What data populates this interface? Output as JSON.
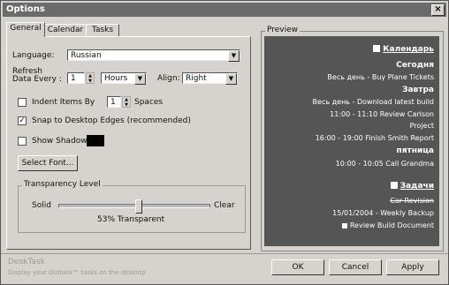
{
  "window": {
    "title": "Options"
  },
  "tabs": [
    "General",
    "Calendar",
    "Tasks"
  ],
  "general": {
    "language_label": "Language:",
    "language_value": "Russian",
    "refresh_label_line1": "Refresh",
    "refresh_label_line2": "Data Every :",
    "refresh_value": "1",
    "refresh_unit": "Hours",
    "align_label": "Align:",
    "align_value": "Right",
    "indent_label": "Indent Items By",
    "indent_value": "1",
    "indent_unit": "Spaces",
    "snap_label": "Snap to Desktop Edges (recommended)",
    "shadow_label": "Show Shadow",
    "select_font_label": "Select Font...",
    "transparency_group": "Transparency Level",
    "solid_label": "Solid",
    "clear_label": "Clear",
    "transparency_text": "53% Transparent",
    "transparency_fraction": 0.53
  },
  "preview": {
    "label": "Preview",
    "calendar_title": "Календарь",
    "today": "Сегодня",
    "today_item": "Весь день - Buy Plane Tickets",
    "tomorrow": "Завтра",
    "tomorrow_item": "Весь день - Download latest build",
    "tomorrow_item2_l1": "11:00 - 11:10 Review Carlson",
    "tomorrow_item2_l2": "Project",
    "tomorrow_item3": "16:00 - 19:00 Finish Smith Report",
    "friday": "пятница",
    "friday_item": "10:00 - 10:05 Call Grandma",
    "tasks_title": "Задачи",
    "task1": "Car Revision",
    "task2": "15/01/2004 - Weekly Backup",
    "task3": "Review Build Document"
  },
  "footer": {
    "app_name": "DeskTask",
    "tagline": "Display your Outlook™ tasks on the desktop"
  },
  "buttons": {
    "ok": "OK",
    "cancel": "Cancel",
    "apply": "Apply"
  },
  "colors": {
    "preview_bg": "#555555",
    "titlebar": "#6b6b6b",
    "dialog_bg": "#d6d3ce"
  }
}
